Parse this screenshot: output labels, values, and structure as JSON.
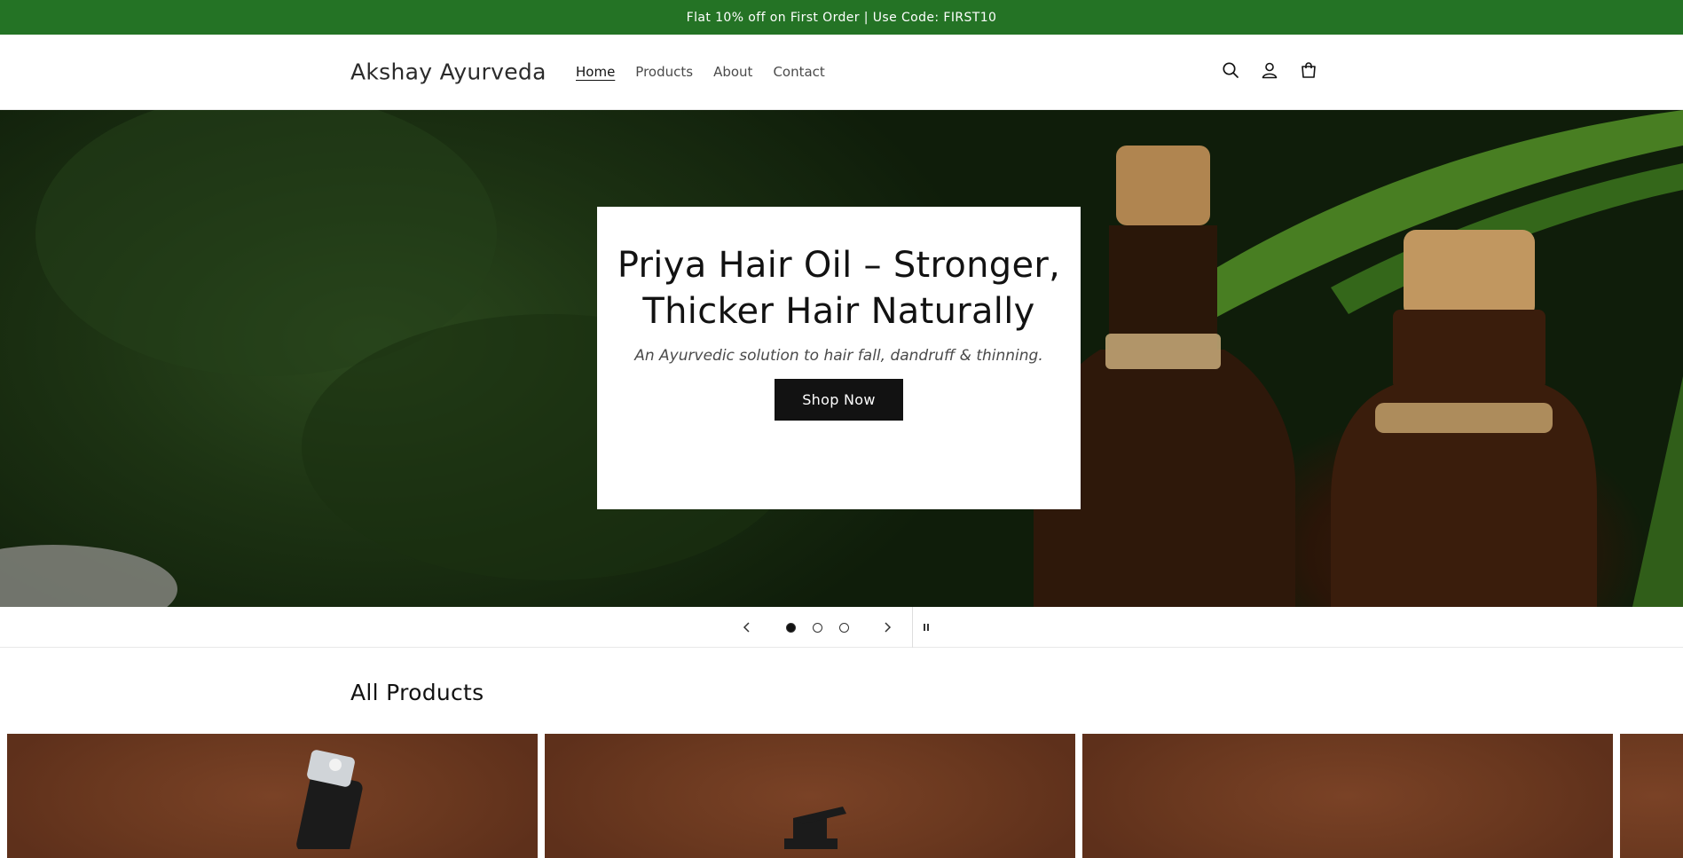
{
  "announcement": "Flat 10% off on First Order | Use Code: FIRST10",
  "header": {
    "logo": "Akshay Ayurveda",
    "nav": [
      "Home",
      "Products",
      "About",
      "Contact"
    ],
    "active_nav": "Home",
    "icons": [
      "search-icon",
      "account-icon",
      "cart-icon"
    ]
  },
  "hero": {
    "title": "Priya Hair Oil – Stronger, Thicker Hair Naturally",
    "subtitle": "An Ayurvedic solution to hair fall, dandruff & thinning.",
    "cta": "Shop Now"
  },
  "slider": {
    "slide_count": 3,
    "current_slide": 1,
    "controls": [
      "prev-arrow-icon",
      "next-arrow-icon",
      "pause-icon"
    ]
  },
  "products_section": {
    "title": "All Products"
  },
  "colors": {
    "announcement_bg": "#247325",
    "button_bg": "#121212",
    "text": "#121212"
  }
}
